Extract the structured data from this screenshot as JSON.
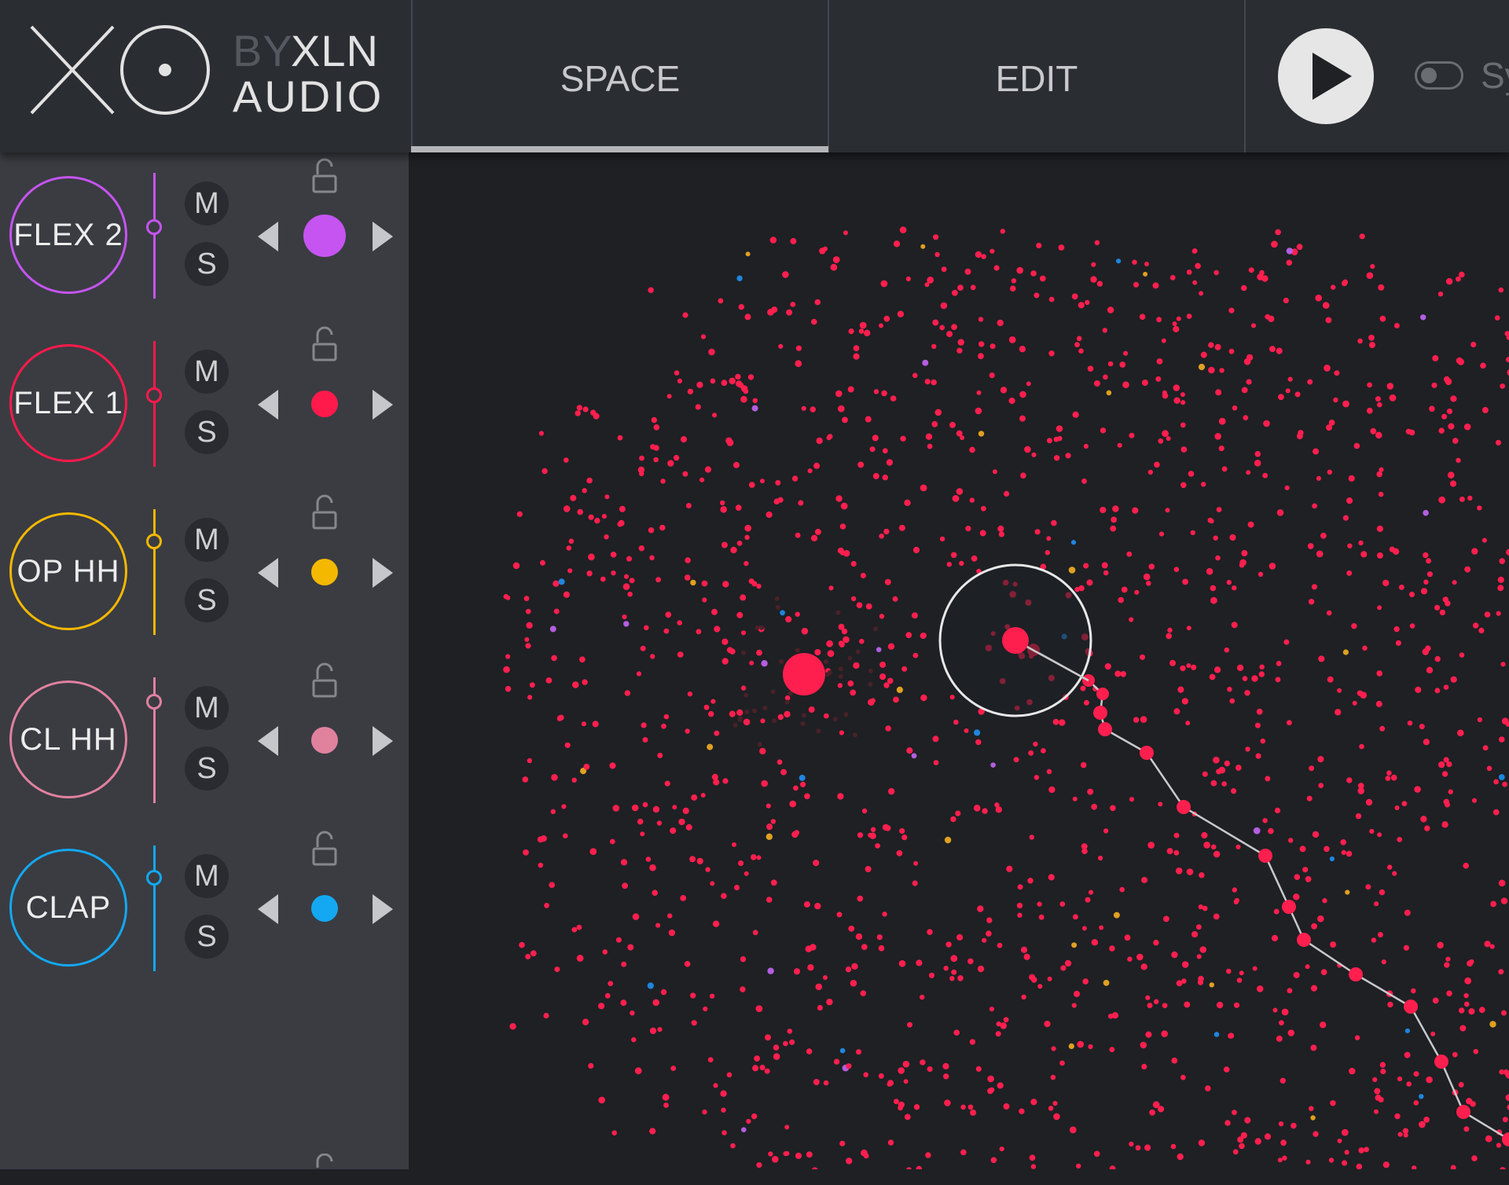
{
  "header": {
    "brand_by": "BY",
    "brand_xln": "XLN",
    "brand_audio": "AUDIO",
    "tabs": [
      {
        "label": "SPACE",
        "active": true
      },
      {
        "label": "EDIT",
        "active": false
      }
    ],
    "play_icon": "play-icon",
    "sync_label": "Sy"
  },
  "colors": {
    "header_bg": "#2a2d32",
    "panel_bg": "#3a3c42",
    "map_bg": "#1e2024",
    "sample_dot": "#ff1f4e",
    "collapse_tab": "#9c1a33"
  },
  "tracks": [
    {
      "label": "FLEX 2",
      "color": "#c554f0",
      "volume": 0.58,
      "mute_label": "M",
      "solo_label": "S",
      "dot_size": "large"
    },
    {
      "label": "FLEX 1",
      "color": "#ff1a4b",
      "volume": 0.58,
      "mute_label": "M",
      "solo_label": "S",
      "dot_size": "medium"
    },
    {
      "label": "OP HH",
      "color": "#f5b800",
      "volume": 0.78,
      "mute_label": "M",
      "solo_label": "S",
      "dot_size": "medium"
    },
    {
      "label": "CL HH",
      "color": "#e0819e",
      "volume": 0.85,
      "mute_label": "M",
      "solo_label": "S",
      "dot_size": "medium"
    },
    {
      "label": "CLAP",
      "color": "#14a8f2",
      "volume": 0.78,
      "mute_label": "M",
      "solo_label": "S",
      "dot_size": "medium"
    }
  ],
  "icons": {
    "lock": "unlock-icon",
    "prev": "triangle-left-icon",
    "next": "triangle-right-icon",
    "collapse": "chevron-left-icon"
  }
}
